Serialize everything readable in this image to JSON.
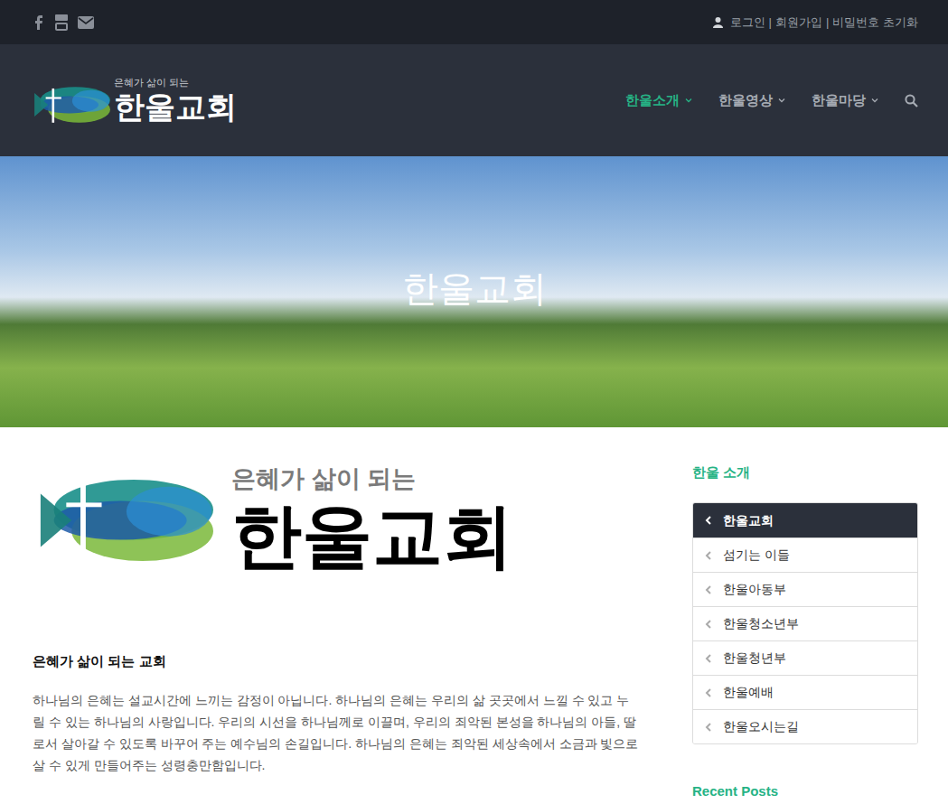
{
  "top_bar": {
    "auth_links": [
      {
        "label": "로그인"
      },
      {
        "label": "회원가입"
      },
      {
        "label": "비밀번호 초기화"
      }
    ],
    "separator": "|"
  },
  "header": {
    "logo": {
      "tagline": "은혜가 삶이 되는",
      "name": "한울교회"
    },
    "nav": [
      {
        "label": "한울소개",
        "selected": true
      },
      {
        "label": "한울영상",
        "selected": false
      },
      {
        "label": "한울마당",
        "selected": false
      }
    ]
  },
  "hero": {
    "title": "한울교회"
  },
  "content": {
    "logo": {
      "tagline": "은혜가 삶이 되는",
      "name": "한울교회"
    },
    "heading": "은혜가 삶이 되는 교회",
    "paragraph": "하나님의 은혜는 설교시간에 느끼는 감정이 아닙니다. 하나님의 은혜는 우리의 삶 곳곳에서 느낄 수 있고 누릴 수 있는 하나님의 사랑입니다. 우리의 시선을 하나님께로 이끌며, 우리의 죄악된 본성을 하나님의 아들, 딸로서 살아갈 수 있도록 바꾸어 주는 예수님의 손길입니다. 하나님의 은혜는 죄악된 세상속에서 소금과 빛으로 살 수 있게 만들어주는 성령충만함입니다."
  },
  "sidebar": {
    "title": "한울 소개",
    "items": [
      {
        "label": "한울교회",
        "selected": true
      },
      {
        "label": "섬기는 이들",
        "selected": false
      },
      {
        "label": "한울아동부",
        "selected": false
      },
      {
        "label": "한울청소년부",
        "selected": false
      },
      {
        "label": "한울청년부",
        "selected": false
      },
      {
        "label": "한울예배",
        "selected": false
      },
      {
        "label": "한울오시는길",
        "selected": false
      }
    ],
    "recent_title": "Recent Posts"
  }
}
